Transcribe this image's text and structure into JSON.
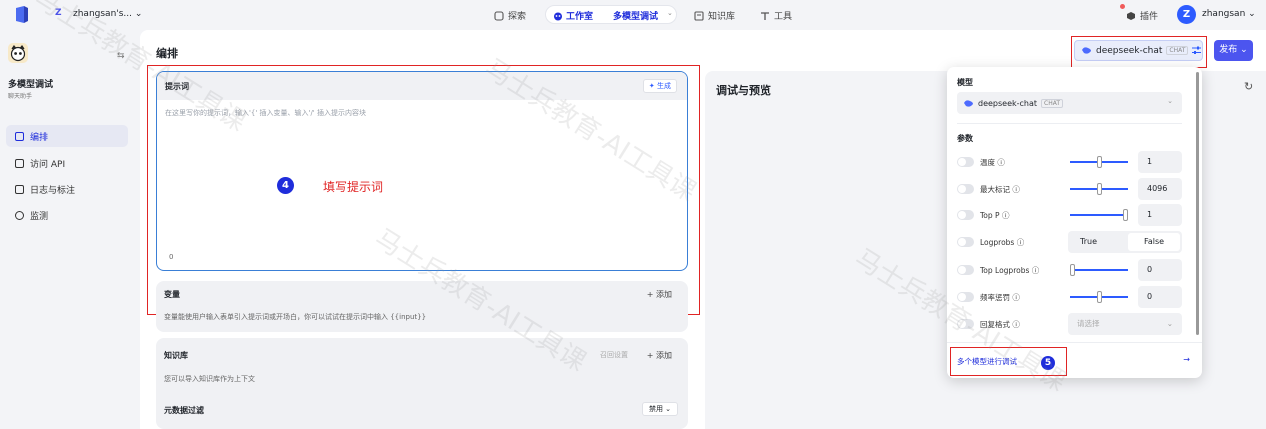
{
  "topnav": {
    "workspace_initial": "Z",
    "workspace_name": "zhangsan's... ⌄",
    "explore": "探索",
    "studio": "工作室",
    "multi_debug": "多模型调试",
    "multi_debug_chevron": "⌄",
    "knowledge": "知识库",
    "tools": "工具",
    "plugins": "插件",
    "user_initial": "Z",
    "user_name": "zhangsan ⌄"
  },
  "sidebar": {
    "bot_name": "多模型调试",
    "bot_sub": "聊天助手",
    "items": [
      {
        "label": "编排"
      },
      {
        "label": "访问 API"
      },
      {
        "label": "日志与标注"
      },
      {
        "label": "监测"
      }
    ]
  },
  "main": {
    "page_title": "编排",
    "model_name": "deepseek-chat",
    "model_tag": "CHAT",
    "publish": "发布 ⌄",
    "prompt": {
      "title": "提示词",
      "generate": "✦ 生成",
      "placeholder": "在这里写你的提示词，输入'{' 插入变量、输入'/' 插入提示内容块",
      "count": "0"
    },
    "annotation_step4": "4",
    "annotation_step4_label": "填写提示词",
    "variables": {
      "title": "变量",
      "add": "+ 添加",
      "desc": "变量能使用户输入表单引入提示词或开场白，你可以试试在提示词中输入 {{input}}"
    },
    "knowledge": {
      "title": "知识库",
      "recall": "召回设置",
      "add": "+ 添加",
      "desc": "您可以导入知识库作为上下文"
    },
    "metadata": {
      "title": "元数据过滤",
      "disable": "禁用 ⌄"
    },
    "preview_title": "调试与预览"
  },
  "dropdown": {
    "model_label": "模型",
    "model_name": "deepseek-chat",
    "model_tag": "CHAT",
    "params_label": "参数",
    "params": [
      {
        "name": "温度",
        "value": "1",
        "slider": 0.5
      },
      {
        "name": "最大标记",
        "value": "4096",
        "slider": 0.5
      },
      {
        "name": "Top P",
        "value": "1",
        "slider": 1.0
      },
      {
        "name": "Logprobs",
        "true_label": "True",
        "false_label": "False"
      },
      {
        "name": "Top Logprobs",
        "value": "0",
        "slider": 0.0
      },
      {
        "name": "频率惩罚",
        "value": "0",
        "slider": 0.5
      },
      {
        "name": "回复格式",
        "placeholder": "请选择"
      }
    ],
    "multi_model": "多个模型进行调试",
    "foot_arrow": "→",
    "annotation_step5": "5"
  },
  "watermark": "马士兵教育-AI工具课"
}
